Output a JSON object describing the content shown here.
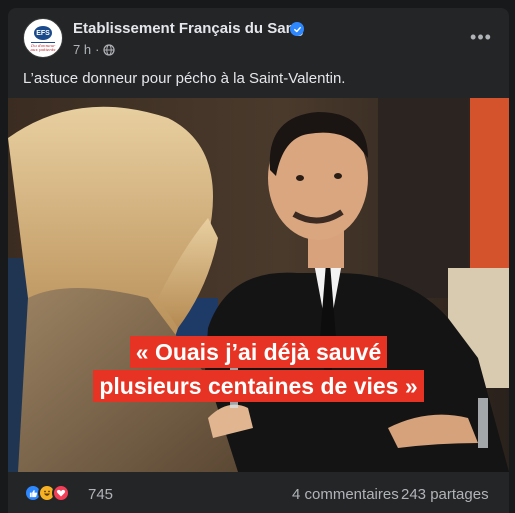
{
  "post": {
    "page_name": "Etablissement Français du Sang",
    "timestamp": "7 h",
    "meta_separator": "·",
    "caption": "L’astuce donneur pour pécho à la Saint-Valentin.",
    "avatar": {
      "logo_text": "EFS",
      "tagline_line1": "Du donneur",
      "tagline_line2": "aux patients"
    },
    "more_label": "•••",
    "image": {
      "quote_line1": "« Ouais j’ai déjà sauvé",
      "quote_line2": "plusieurs centaines de vies »"
    },
    "footer": {
      "reaction_count": "745",
      "comments": "4 commentaires",
      "shares": "243 partages"
    }
  },
  "icons": {
    "verified": "verified-badge-icon",
    "audience": "globe-icon",
    "reactions": [
      "like-reaction-icon",
      "haha-reaction-icon",
      "love-reaction-icon"
    ]
  },
  "colors": {
    "background": "#18191a",
    "card": "#242526",
    "primary_text": "#e4e6eb",
    "secondary_text": "#b0b3b8",
    "verified": "#2d88ff",
    "quote_highlight": "#e63323"
  }
}
